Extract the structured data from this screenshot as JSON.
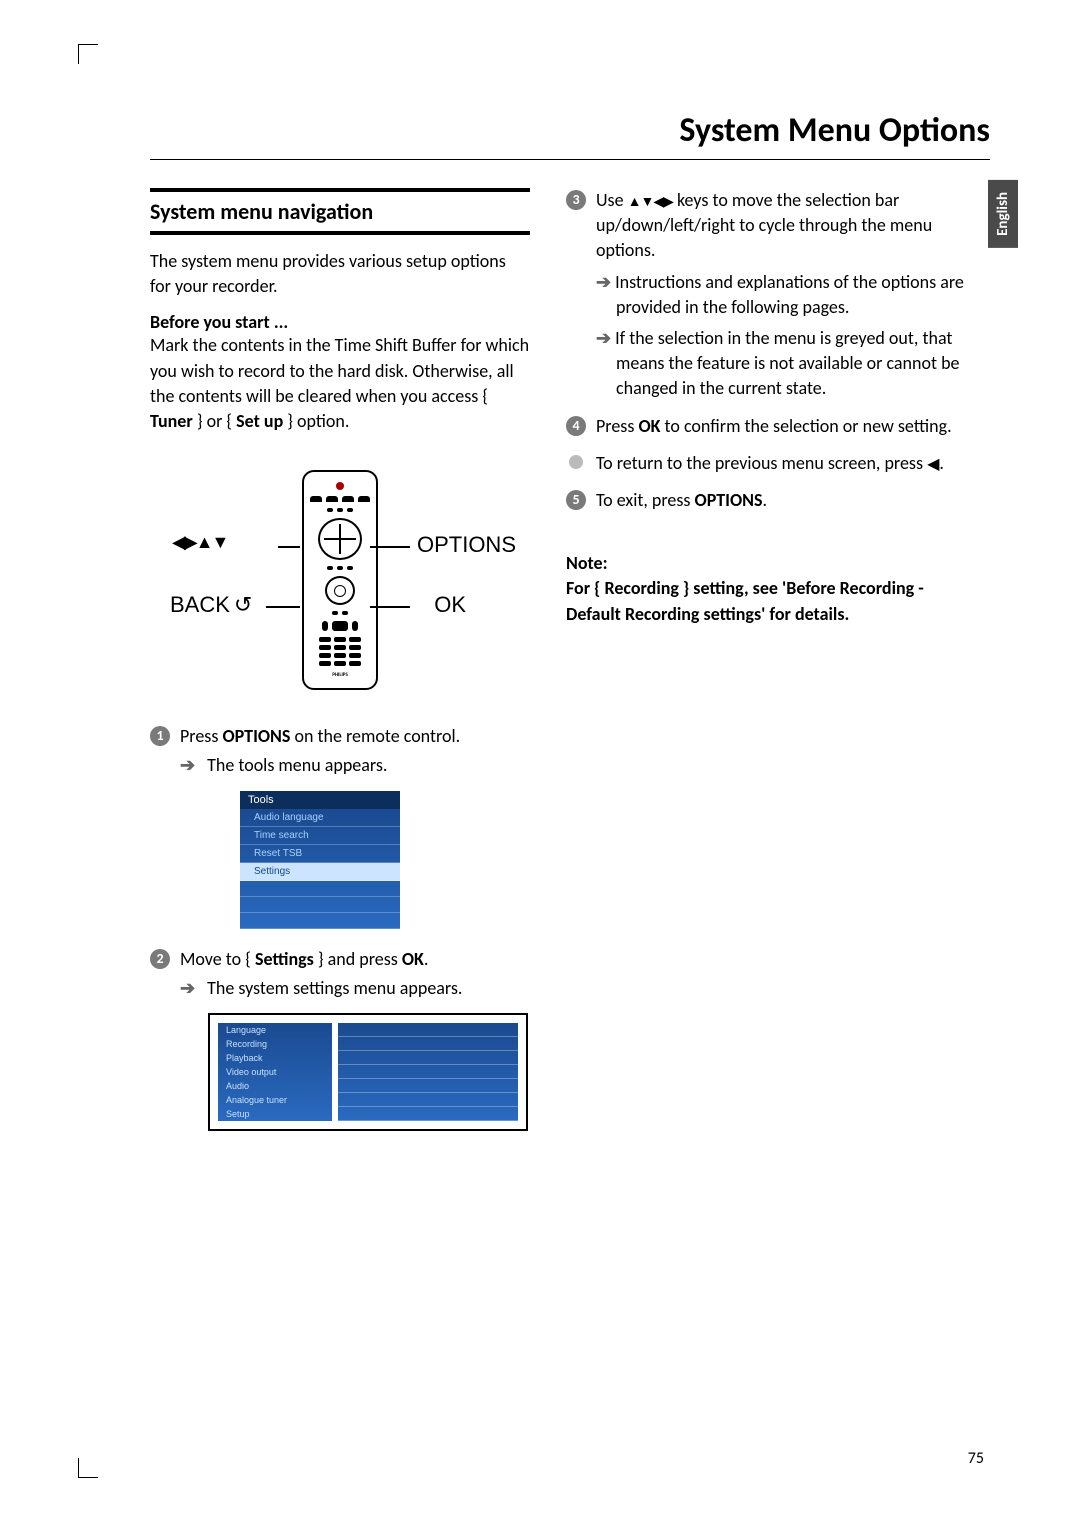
{
  "page_title": "System Menu Options",
  "language_tab": "English",
  "page_number": "75",
  "left": {
    "heading": "System menu navigation",
    "intro": "The system menu provides various setup options for your recorder.",
    "before_label": "Before you start ...",
    "before_text": "Mark the contents in the Time Shift Buffer for which you wish to record to the hard disk. Otherwise, all the contents will be cleared when you access { ",
    "before_tuner": "Tuner",
    "before_mid": " } or { ",
    "before_setup": "Set up",
    "before_end": " } option.",
    "diagram": {
      "options": "OPTIONS",
      "ok": "OK",
      "back": "BACK",
      "back_icon": "↺",
      "arrows": "◀▶▲▼"
    },
    "step1_num": "1",
    "step1_a": "Press ",
    "step1_b": "OPTIONS",
    "step1_c": " on the remote control.",
    "step1_sub": "The tools menu appears.",
    "tools_menu": {
      "header": "Tools",
      "items": [
        "Audio language",
        "Time search",
        "Reset TSB",
        "Settings"
      ]
    },
    "step2_num": "2",
    "step2_a": "Move to { ",
    "step2_b": "Settings",
    "step2_c": " } and press ",
    "step2_d": "OK",
    "step2_e": ".",
    "step2_sub": "The system settings menu appears.",
    "settings_menu": {
      "items": [
        "Language",
        "Recording",
        "Playback",
        "Video output",
        "Audio",
        "Analogue tuner",
        "Setup"
      ]
    }
  },
  "right": {
    "step3_num": "3",
    "step3_a": "Use ",
    "step3_keys": "▲▼◀▶",
    "step3_b": " keys to move the selection bar up/down/left/right to cycle through the menu options.",
    "step3_sub1": "Instructions and explanations of the options are provided in the following pages.",
    "step3_sub2": "If the selection in the menu is greyed out, that means the feature is not available or cannot be changed in the current state.",
    "step4_num": "4",
    "step4_a": "Press ",
    "step4_b": "OK",
    "step4_c": " to confirm the selection or new setting.",
    "bullet_a": "To return to the previous menu screen, press ",
    "bullet_key": "◀",
    "bullet_b": ".",
    "step5_num": "5",
    "step5_a": "To exit, press ",
    "step5_b": "OPTIONS",
    "step5_c": ".",
    "note_label": "Note:",
    "note_body": "For { Recording } setting, see 'Before Recording - Default Recording settings' for details."
  }
}
